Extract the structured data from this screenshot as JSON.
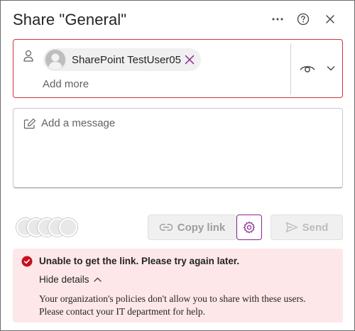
{
  "dialog": {
    "title": "Share \"General\""
  },
  "picker": {
    "recipient": "SharePoint TestUser05",
    "add_more_placeholder": "Add more"
  },
  "message": {
    "placeholder": "Add a message"
  },
  "actions": {
    "copy_link_label": "Copy link",
    "send_label": "Send"
  },
  "error": {
    "title": "Unable to get the link. Please try again later.",
    "toggle_label": "Hide details",
    "line1": "Your organization's policies don't allow you to share with these users.",
    "line2": "Please contact your IT department for help."
  },
  "icons": {
    "more": "more-horizontal-icon",
    "help": "help-circle-icon",
    "close": "close-icon",
    "person": "person-icon",
    "remove": "dismiss-icon",
    "permission": "eye-icon",
    "chevron": "chevron-down-icon",
    "compose": "compose-icon",
    "link": "link-icon",
    "settings": "gear-icon",
    "send": "send-icon",
    "error": "error-circle-icon",
    "collapse": "chevron-up-icon"
  },
  "colors": {
    "error_border": "#d13438",
    "error_bg": "#fde7e9",
    "error_icon": "#c50f1f",
    "accent": "#8a2791",
    "disabled_text": "#9e9e9e"
  }
}
